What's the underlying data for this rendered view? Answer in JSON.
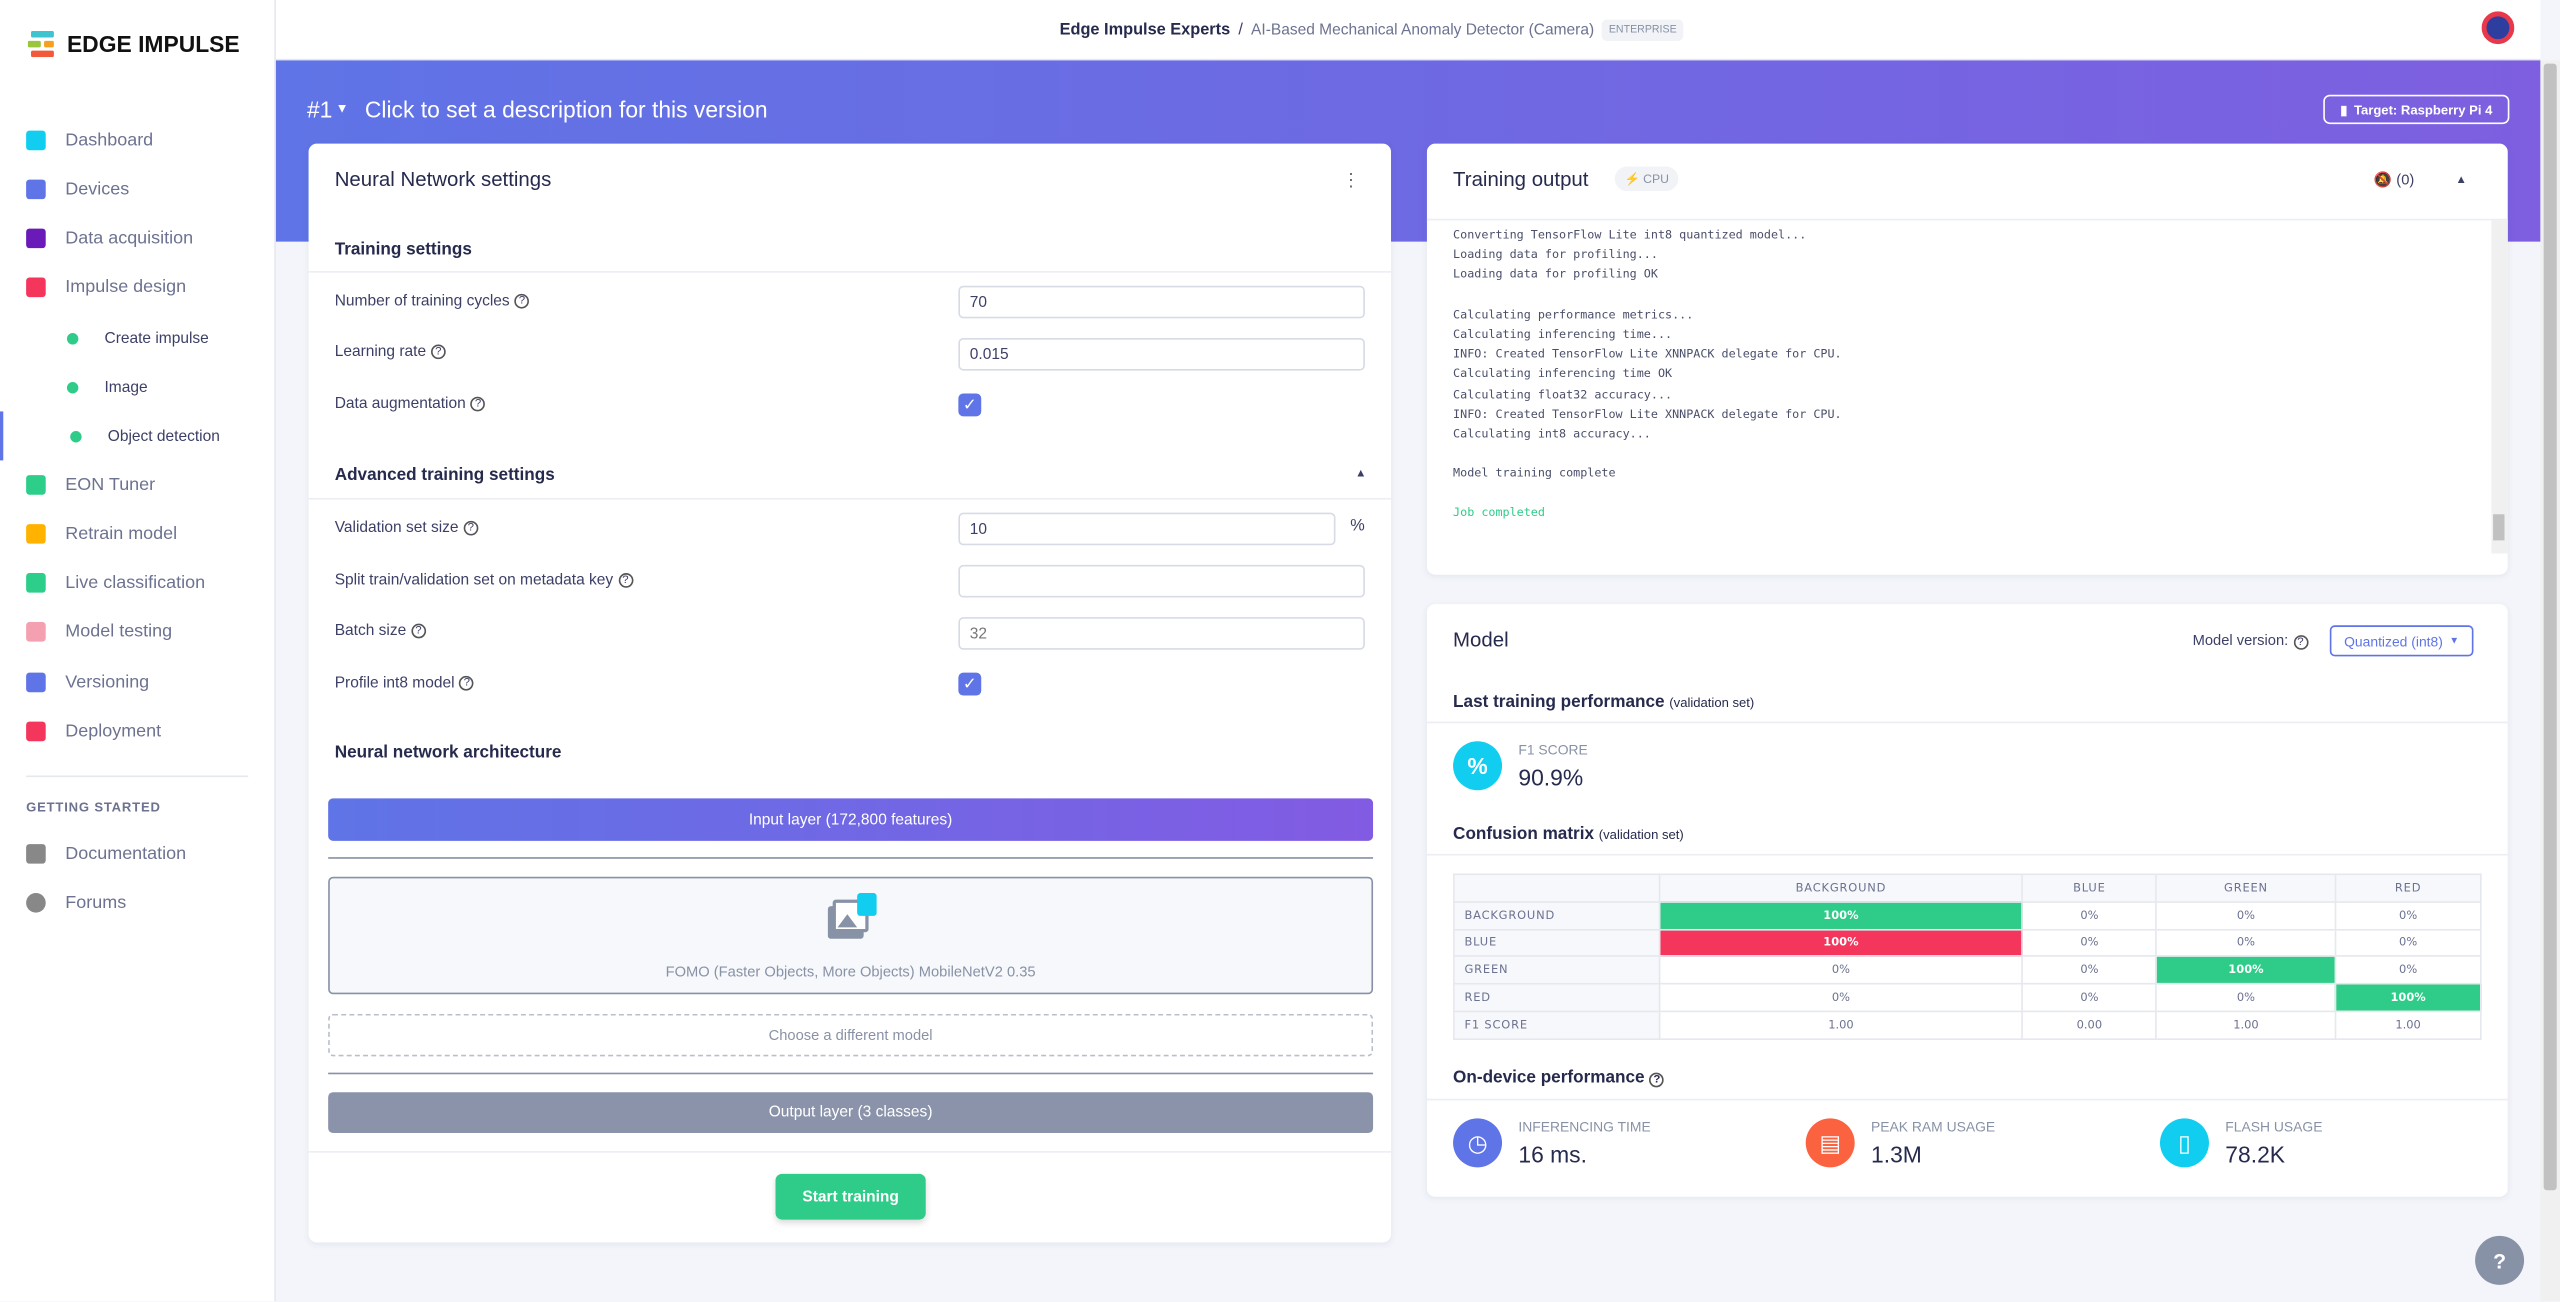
{
  "brand": {
    "name": "EDGE IMPULSE"
  },
  "sidebar": {
    "items": [
      {
        "label": "Dashboard",
        "icon": "monitor-icon",
        "color": "#11cdef"
      },
      {
        "label": "Devices",
        "icon": "chip-icon",
        "color": "#5f74e6"
      },
      {
        "label": "Data acquisition",
        "icon": "database-icon",
        "color": "#6a1ab8"
      },
      {
        "label": "Impulse design",
        "icon": "pulse-icon",
        "color": "#f5365c"
      },
      {
        "label": "Create impulse"
      },
      {
        "label": "Image"
      },
      {
        "label": "Object detection",
        "active": true
      },
      {
        "label": "EON Tuner",
        "icon": "compass-icon",
        "color": "#2dce89"
      },
      {
        "label": "Retrain model",
        "icon": "shuffle-icon",
        "color": "#ffb300"
      },
      {
        "label": "Live classification",
        "icon": "nodes-icon",
        "color": "#2dce89"
      },
      {
        "label": "Model testing",
        "icon": "clipboard-icon",
        "color": "#f5a0b0"
      },
      {
        "label": "Versioning",
        "icon": "branch-icon",
        "color": "#5f74e6"
      },
      {
        "label": "Deployment",
        "icon": "box-icon",
        "color": "#f5365c"
      }
    ],
    "section": "GETTING STARTED",
    "extra": [
      {
        "label": "Documentation",
        "icon": "book-icon"
      },
      {
        "label": "Forums",
        "icon": "chat-icon"
      }
    ]
  },
  "header": {
    "org": "Edge Impulse Experts",
    "sep": "/",
    "project": "AI-Based Mechanical Anomaly Detector (Camera)",
    "badge": "ENTERPRISE"
  },
  "version": {
    "number": "#1",
    "description": "Click to set a description for this version",
    "target": "Target: Raspberry Pi 4"
  },
  "nn": {
    "title": "Neural Network settings",
    "training_settings": "Training settings",
    "cycles_label": "Number of training cycles",
    "cycles": "70",
    "lr_label": "Learning rate",
    "lr": "0.015",
    "aug_label": "Data augmentation",
    "aug": true,
    "advanced": "Advanced training settings",
    "val_label": "Validation set size",
    "val": "10",
    "val_unit": "%",
    "split_label": "Split train/validation set on metadata key",
    "split": "",
    "batch_label": "Batch size",
    "batch_placeholder": "32",
    "int8_label": "Profile int8 model",
    "int8": true,
    "arch": "Neural network architecture",
    "input_layer": "Input layer (172,800 features)",
    "model_name": "FOMO (Faster Objects, More Objects) MobileNetV2 0.35",
    "choose": "Choose a different model",
    "output_layer": "Output layer (3 classes)",
    "start": "Start training"
  },
  "output": {
    "title": "Training output",
    "cpu": "CPU",
    "notif": "(0)",
    "log": "Converting TensorFlow Lite int8 quantized model...\nLoading data for profiling...\nLoading data for profiling OK\n\nCalculating performance metrics...\nCalculating inferencing time...\nINFO: Created TensorFlow Lite XNNPACK delegate for CPU.\nCalculating inferencing time OK\nCalculating float32 accuracy...\nINFO: Created TensorFlow Lite XNNPACK delegate for CPU.\nCalculating int8 accuracy...\n\nModel training complete\n",
    "done": "Job completed"
  },
  "model": {
    "title": "Model",
    "version_label": "Model version:",
    "version": "Quantized (int8)",
    "last_perf": "Last training performance",
    "val_set": "(validation set)",
    "f1_label": "F1 SCORE",
    "f1": "90.9%",
    "cm_title": "Confusion matrix",
    "cm_sub": "(validation set)",
    "cm_cols": [
      "BACKGROUND",
      "BLUE",
      "GREEN",
      "RED"
    ],
    "cm_rows": [
      {
        "label": "BACKGROUND",
        "cells": [
          "100%",
          "0%",
          "0%",
          "0%"
        ],
        "hl": [
          "g",
          "",
          "",
          ""
        ]
      },
      {
        "label": "BLUE",
        "cells": [
          "100%",
          "0%",
          "0%",
          "0%"
        ],
        "hl": [
          "r",
          "",
          "",
          ""
        ]
      },
      {
        "label": "GREEN",
        "cells": [
          "0%",
          "0%",
          "100%",
          "0%"
        ],
        "hl": [
          "",
          "",
          "g",
          ""
        ]
      },
      {
        "label": "RED",
        "cells": [
          "0%",
          "0%",
          "0%",
          "100%"
        ],
        "hl": [
          "",
          "",
          "",
          "g"
        ]
      },
      {
        "label": "F1 SCORE",
        "cells": [
          "1.00",
          "0.00",
          "1.00",
          "1.00"
        ],
        "hl": [
          "",
          "",
          "",
          ""
        ]
      }
    ],
    "ondevice": "On-device performance",
    "perf": [
      {
        "label": "INFERENCING TIME",
        "value": "16 ms.",
        "color": "#5f74e6",
        "icon": "clock-icon"
      },
      {
        "label": "PEAK RAM USAGE",
        "value": "1.3M",
        "color": "#fb6340",
        "icon": "ram-icon"
      },
      {
        "label": "FLASH USAGE",
        "value": "78.2K",
        "color": "#11cdef",
        "icon": "chip-icon"
      }
    ]
  }
}
